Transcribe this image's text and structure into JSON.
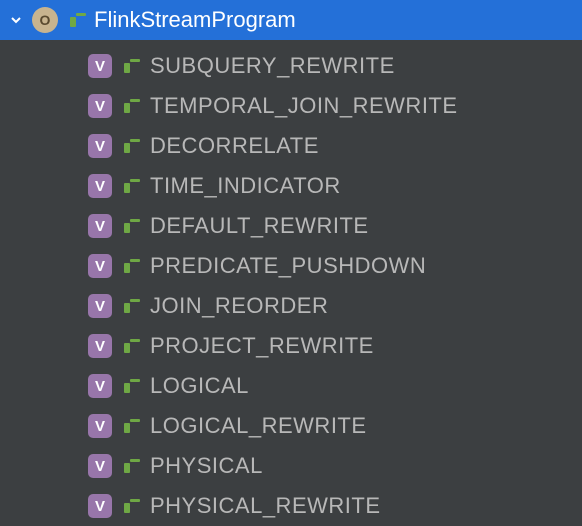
{
  "header": {
    "avatar_letter": "O",
    "title": "FlinkStreamProgram"
  },
  "tree": {
    "items": [
      {
        "badge": "V",
        "label": "SUBQUERY_REWRITE"
      },
      {
        "badge": "V",
        "label": "TEMPORAL_JOIN_REWRITE"
      },
      {
        "badge": "V",
        "label": "DECORRELATE"
      },
      {
        "badge": "V",
        "label": "TIME_INDICATOR"
      },
      {
        "badge": "V",
        "label": "DEFAULT_REWRITE"
      },
      {
        "badge": "V",
        "label": "PREDICATE_PUSHDOWN"
      },
      {
        "badge": "V",
        "label": "JOIN_REORDER"
      },
      {
        "badge": "V",
        "label": "PROJECT_REWRITE"
      },
      {
        "badge": "V",
        "label": "LOGICAL"
      },
      {
        "badge": "V",
        "label": "LOGICAL_REWRITE"
      },
      {
        "badge": "V",
        "label": "PHYSICAL"
      },
      {
        "badge": "V",
        "label": "PHYSICAL_REWRITE"
      }
    ]
  }
}
